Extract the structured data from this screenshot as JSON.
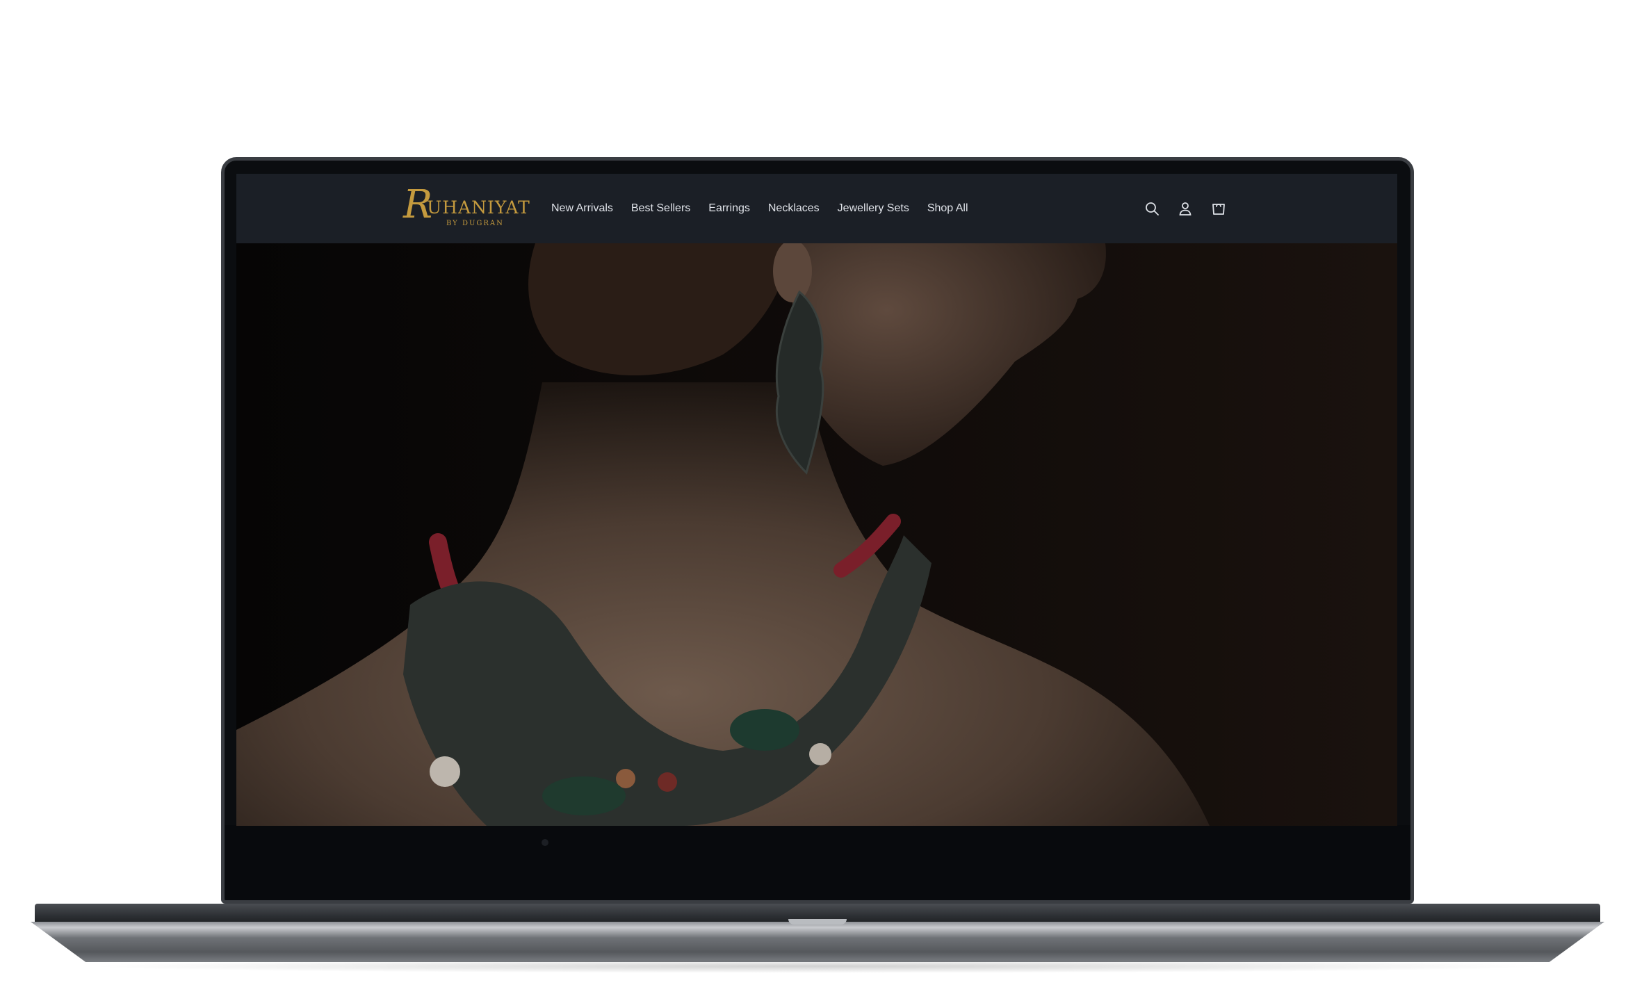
{
  "brand": {
    "logo_initial": "R",
    "logo_name": "UHANIYAT",
    "logo_subtitle": "BY DUGRAN",
    "logo_color": "#c49a3e",
    "header_bg": "#1b1f26"
  },
  "nav": {
    "items": [
      {
        "label": "New Arrivals"
      },
      {
        "label": "Best Sellers"
      },
      {
        "label": "Earrings"
      },
      {
        "label": "Necklaces"
      },
      {
        "label": "Jewellery Sets"
      },
      {
        "label": "Shop All"
      }
    ]
  },
  "header_icons": [
    {
      "name": "search-icon"
    },
    {
      "name": "account-icon"
    },
    {
      "name": "cart-icon"
    }
  ],
  "hero": {
    "image_subject": "model-wearing-necklace-and-earrings"
  }
}
